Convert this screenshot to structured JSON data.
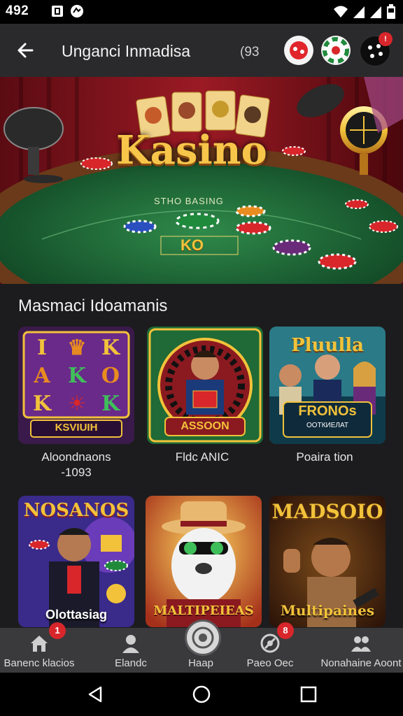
{
  "status_bar": {
    "time": "492"
  },
  "app_bar": {
    "title": "Unganci Inmadisa",
    "count": "(93",
    "notification_badge": "!"
  },
  "hero": {
    "brand": "Kasino",
    "table_text": "STHO BASING",
    "table_logo": "KO"
  },
  "section": {
    "title": "Masmaci Idoamanis"
  },
  "games": [
    {
      "art_title": "KSVIUIH",
      "caption": "Aloondnaons",
      "caption2": "-1093",
      "theme": "slots"
    },
    {
      "art_title": "ASSOON",
      "caption": "Fldc ANIC",
      "caption2": "",
      "theme": "roulette"
    },
    {
      "art_title": "Pluulla",
      "art_sub": "FRONOs",
      "art_sub2": "ООТКИЕЛАТ",
      "caption": "Poaira tion",
      "caption2": "",
      "theme": "poker"
    },
    {
      "art_title": "NOSANOS",
      "art_bottom": "Olottasiag",
      "caption": "",
      "theme": "casino-man"
    },
    {
      "art_title": "MALTIPEIEAS",
      "caption": "",
      "theme": "seal"
    },
    {
      "art_title": "MADSOIO",
      "art_bottom": "Multipaines",
      "caption": "",
      "theme": "thumbs-up"
    }
  ],
  "bottom_nav": [
    {
      "label": "Banenc klacios",
      "icon": "home-icon",
      "badge": "1"
    },
    {
      "label": "Elandc",
      "icon": "user-icon",
      "badge": ""
    },
    {
      "label": "Haap",
      "icon": "chip-icon",
      "badge": ""
    },
    {
      "label": "Paeo Oec",
      "icon": "wheel-icon",
      "badge": "8"
    },
    {
      "label": "Nonahaine Aoont",
      "icon": "group-icon",
      "badge": ""
    }
  ],
  "colors": {
    "accent_red": "#d8262b",
    "felt_green": "#1f6a36",
    "gold": "#f2c23a",
    "background": "#1c1c1e"
  }
}
